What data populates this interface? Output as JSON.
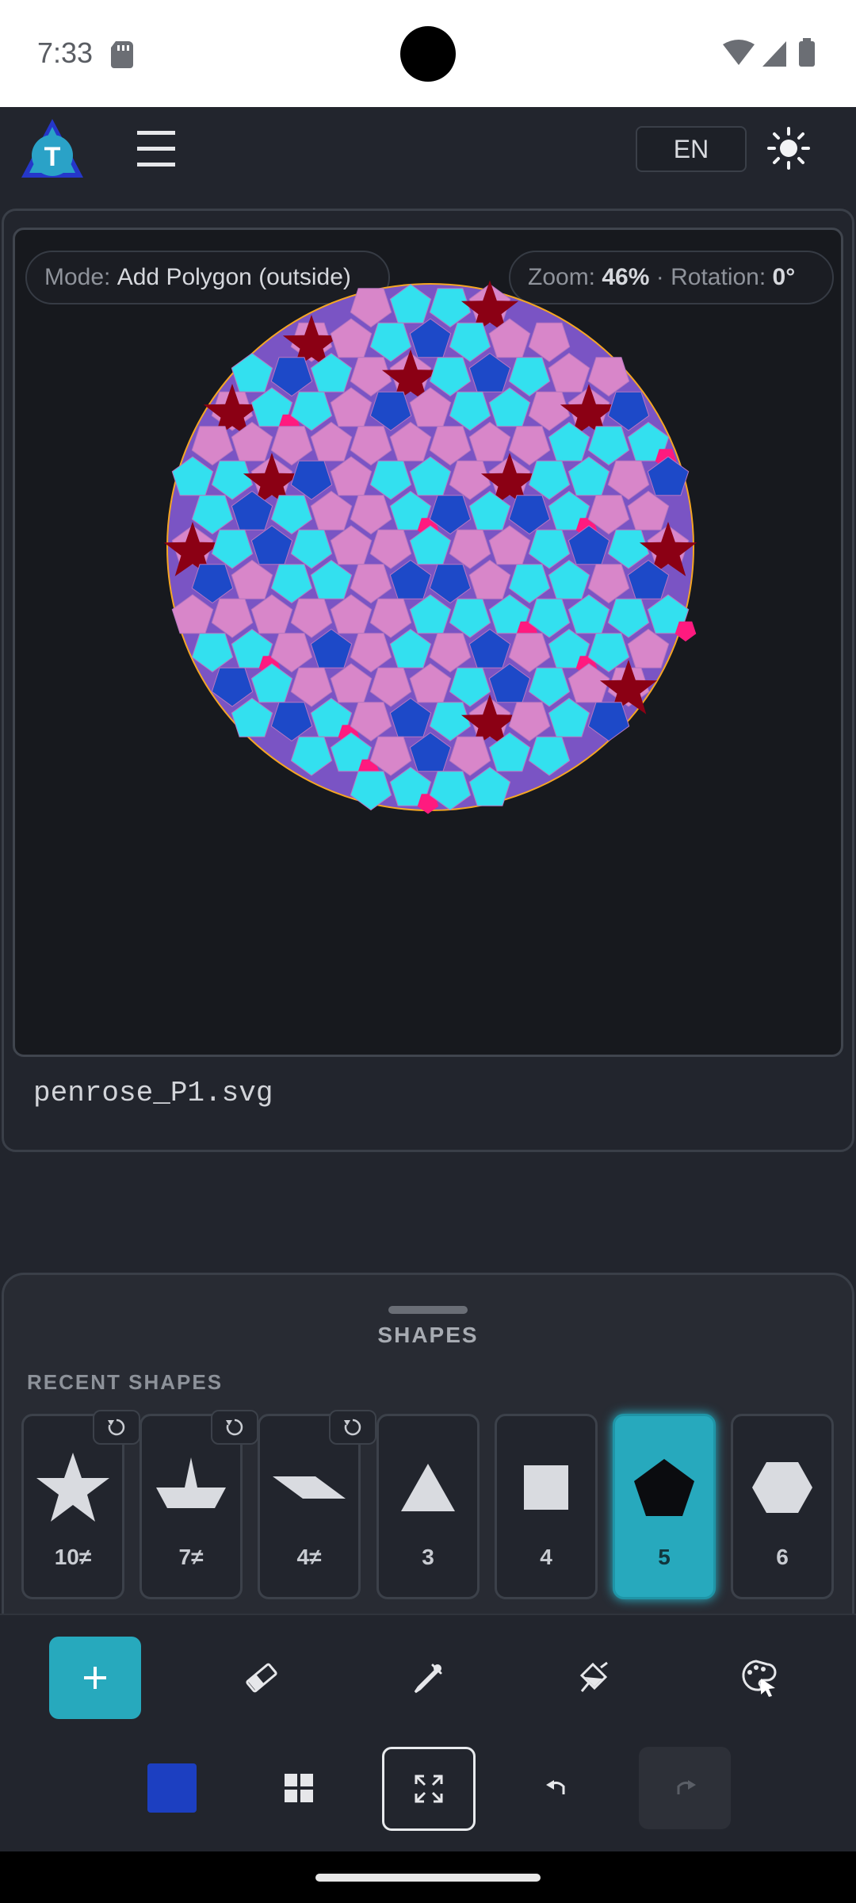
{
  "status_bar": {
    "time": "7:33",
    "icons": [
      "sd-card-icon",
      "wifi-icon",
      "signal-icon",
      "battery-icon"
    ]
  },
  "app_bar": {
    "logo_letter": "T",
    "language": "EN",
    "icons": [
      "hamburger-menu-icon",
      "sun-icon"
    ]
  },
  "canvas": {
    "mode_label": "Mode:",
    "mode_value": "Add Polygon (outside)",
    "zoom_label": "Zoom:",
    "zoom_value": "46%",
    "separator": "·",
    "rotation_label": "Rotation:",
    "rotation_value": "0°",
    "tiling_colors": [
      "#33e0ef",
      "#d886c9",
      "#1d49c8",
      "#ff1a7f",
      "#8b0014",
      "#7a54c4"
    ],
    "tiling_outline": "#f5a623"
  },
  "filename": "penrose_P1.svg",
  "shapes_sheet": {
    "title": "SHAPES",
    "recent_label": "RECENT SHAPES",
    "items": [
      {
        "label": "10≠",
        "icon": "star-icon",
        "resettable": true
      },
      {
        "label": "7≠",
        "icon": "boat-shape-icon",
        "resettable": true
      },
      {
        "label": "4≠",
        "icon": "parallelogram-icon",
        "resettable": true
      },
      {
        "label": "3",
        "icon": "triangle-icon",
        "resettable": false
      },
      {
        "label": "4",
        "icon": "square-icon",
        "resettable": false
      },
      {
        "label": "5",
        "icon": "pentagon-icon",
        "resettable": false,
        "selected": true
      },
      {
        "label": "6",
        "icon": "hexagon-icon",
        "resettable": false
      }
    ]
  },
  "toolbar": {
    "row1": [
      "add-icon",
      "eraser-icon",
      "eyedropper-icon",
      "fill-dropper-icon",
      "palette-cursor-icon"
    ],
    "row2": [
      "color-swatch",
      "grid-icon",
      "fit-screen-icon",
      "undo-icon",
      "redo-icon"
    ],
    "swatch_color": "#1c3fc1",
    "accent": "#27a9bd"
  }
}
